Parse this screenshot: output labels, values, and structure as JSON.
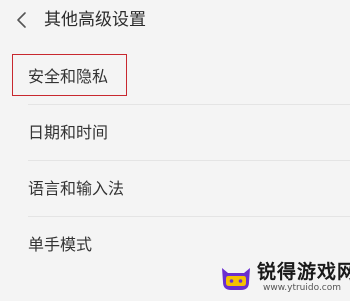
{
  "header": {
    "title": "其他高级设置",
    "back_icon": "chevron-left-icon"
  },
  "menu": {
    "items": [
      {
        "label": "安全和隐私",
        "highlighted": true
      },
      {
        "label": "日期和时间"
      },
      {
        "label": "语言和输入法"
      },
      {
        "label": "单手模式"
      }
    ]
  },
  "watermark": {
    "name": "锐得游戏网",
    "url": "www.ytruido.com",
    "logo_icon": "cat-gamepad-logo"
  },
  "colors": {
    "background": "#f4f4f4",
    "highlight_border": "#c8282f",
    "logo_purple": "#6a2fd0",
    "logo_yellow": "#f5c200"
  }
}
